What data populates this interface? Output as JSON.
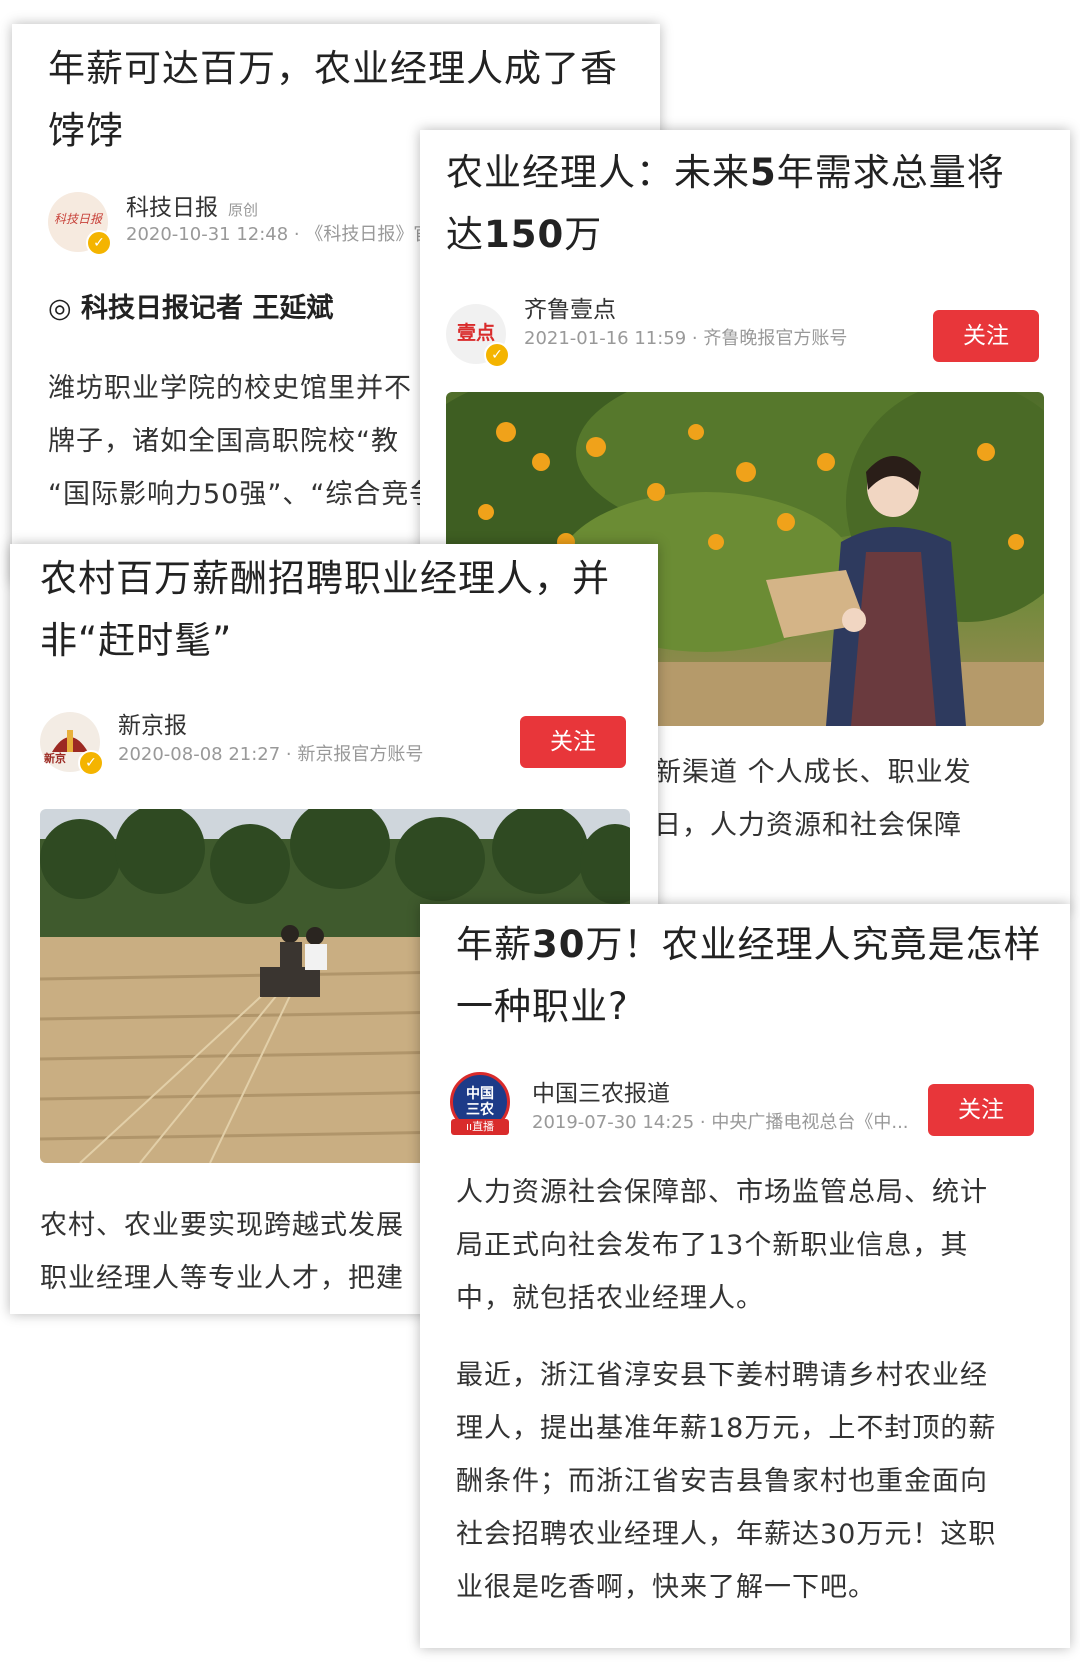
{
  "card1": {
    "title_line1": "年薪可达百万，农业经理人成了香",
    "title_line2": "饽饽",
    "avatar_text": "科技日报",
    "source": "科技日报",
    "source_tag": "原创",
    "meta": "2020-10-31 12:48 · 《科技日报》官",
    "byline": "◎ 科技日报记者 王延斌",
    "body": [
      "潍坊职业学院的校史馆里并不",
      "牌子，诸如全国高职院校“教",
      "“国际影响力50强”、“综合竞争"
    ]
  },
  "card2": {
    "title_a": "农业经理人：未来",
    "title_b": "5",
    "title_c": "年需求总量将",
    "title_d": "达",
    "title_e": "150",
    "title_f": "万",
    "avatar_text": "壹点",
    "source": "齐鲁壹点",
    "meta": "2021-01-16 11:59 · 齐鲁晚报官方账号",
    "follow": "关注",
    "body": [
      "的新渠道 个人成长、职业发",
      "近日，人力资源和社会保障"
    ]
  },
  "card3": {
    "title_line1": "农村百万薪酬招聘职业经理人，并",
    "title_line2": "非“赶时髦”",
    "avatar_text": "新京",
    "source": "新京报",
    "meta": "2020-08-08 21:27 · 新京报官方账号",
    "follow": "关注",
    "body": [
      "农村、农业要实现跨越式发展",
      "职业经理人等专业人才，把建"
    ]
  },
  "card4": {
    "title_a": "年薪",
    "title_b": "30",
    "title_c": "万！农业经理人究竟是怎样",
    "title_line2": "一种职业?",
    "avatar_line1": "中国",
    "avatar_line2": "三农",
    "avatar_live": "直播",
    "source": "中国三农报道",
    "meta": "2019-07-30 14:25 · 中央广播电视总台《中...",
    "follow": "关注",
    "para1": [
      "人力资源社会保障部、市场监管总局、统计",
      "局正式向社会发布了13个新职业信息，其",
      "中，就包括农业经理人。"
    ],
    "para2": [
      "最近，浙江省淳安县下姜村聘请乡村农业经",
      "理人，提出基准年薪18万元，上不封顶的薪",
      "酬条件；而浙江省安吉县鲁家村也重金面向",
      "社会招聘农业经理人，年薪达30万元！这职",
      "业很是吃香啊，快来了解一下吧。"
    ]
  },
  "colors": {
    "follow_red": "#e8363a",
    "verified_gold": "#f4b400"
  }
}
